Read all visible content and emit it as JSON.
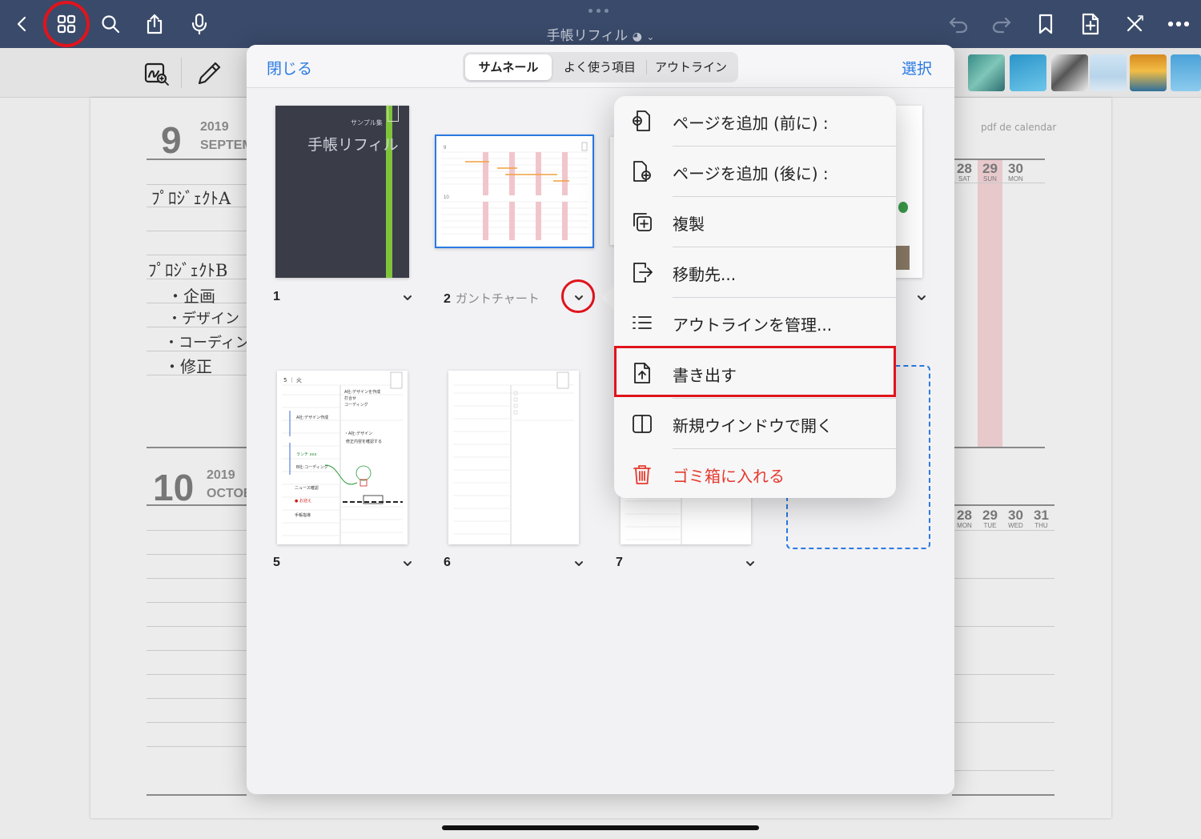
{
  "app": {
    "document_title": "手帳リフィル",
    "accent_color": "#2a7ae2",
    "toolbar_color": "#3a4a6a",
    "highlight_color": "#e0141c"
  },
  "toolbar": {
    "left": [
      "back-icon",
      "grid-icon",
      "search-icon",
      "share-icon",
      "microphone-icon"
    ],
    "right": [
      "undo-icon",
      "redo-icon",
      "bookmark-icon",
      "add-page-icon",
      "close-tools-icon",
      "more-icon"
    ]
  },
  "background_page": {
    "source_label": "pdf de calendar",
    "sept": {
      "month": "9",
      "year": "2019",
      "name": "SEPTEM"
    },
    "oct": {
      "month": "10",
      "year": "2019",
      "name": "OCTOB"
    },
    "notes": [
      "ﾌﾟﾛｼﾞｪｸﾄA",
      "ﾌﾟﾛｼﾞｪｸﾄB",
      "・企画",
      "・デザイン",
      "・コーディング",
      "・修正"
    ],
    "sept_days": [
      {
        "num": "28",
        "dow": "SAT"
      },
      {
        "num": "29",
        "dow": "SUN"
      },
      {
        "num": "30",
        "dow": "MON"
      }
    ],
    "oct_days": [
      {
        "num": "28",
        "dow": "MON"
      },
      {
        "num": "29",
        "dow": "TUE"
      },
      {
        "num": "30",
        "dow": "WED"
      },
      {
        "num": "31",
        "dow": "THU"
      }
    ]
  },
  "sheet": {
    "close_label": "閉じる",
    "select_label": "選択",
    "tabs": [
      {
        "label": "サムネール",
        "active": true
      },
      {
        "label": "よく使う項目",
        "active": false
      },
      {
        "label": "アウトライン",
        "active": false
      }
    ],
    "thumbnails": [
      {
        "number": "1",
        "name": "",
        "cover_text": "手帳リフィル",
        "cover_tag": "サンプル集"
      },
      {
        "number": "2",
        "name": "ガントチャート",
        "selected": true
      },
      {
        "number": "5",
        "name": ""
      },
      {
        "number": "6",
        "name": ""
      },
      {
        "number": "7",
        "name": ""
      }
    ]
  },
  "context_menu": {
    "items": [
      {
        "label": "ページを追加 (前に) :",
        "icon": "add-page-before-icon"
      },
      {
        "label": "ページを追加 (後に) :",
        "icon": "add-page-after-icon"
      },
      {
        "label": "複製",
        "icon": "duplicate-icon"
      },
      {
        "label": "移動先...",
        "icon": "move-icon"
      },
      {
        "label": "アウトラインを管理...",
        "icon": "outline-list-icon"
      },
      {
        "label": "書き出す",
        "icon": "export-icon",
        "highlighted": true
      },
      {
        "label": "新規ウインドウで開く",
        "icon": "new-window-icon"
      },
      {
        "label": "ゴミ箱に入れる",
        "icon": "trash-icon",
        "destructive": true
      }
    ]
  }
}
